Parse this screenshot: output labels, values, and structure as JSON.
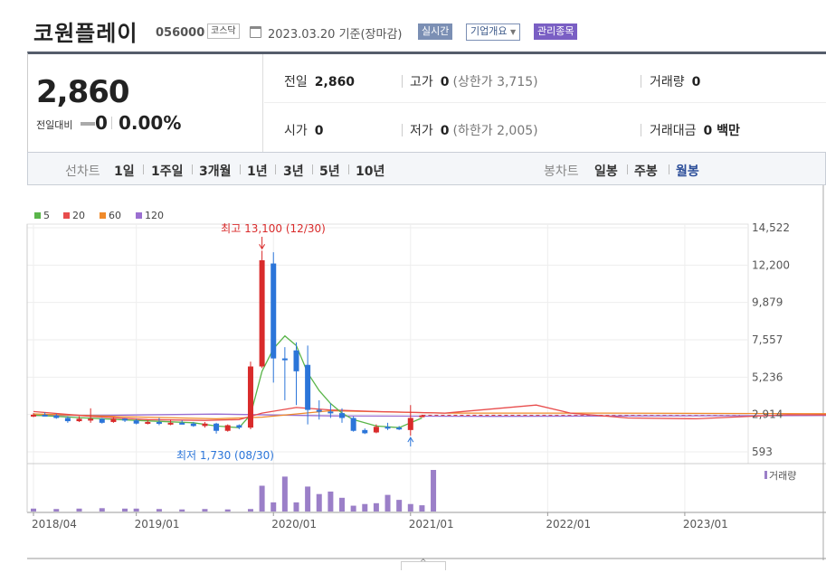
{
  "header": {
    "company_name": "코원플레이",
    "code": "056000",
    "market": "코스닥",
    "as_of": "2023.03.20 기준(장마감)",
    "realtime_label": "실시간",
    "company_overview_label": "기업개요",
    "admin_label": "관리종목"
  },
  "price": {
    "current": "2,860",
    "change_label": "전일대비",
    "change_value": "0",
    "change_pct": "0.00%",
    "prev_label": "전일",
    "prev_value": "2,860",
    "high_label": "고가",
    "high_value": "0",
    "upper_limit_text": "(상한가 3,715)",
    "volume_label": "거래량",
    "volume_value": "0",
    "open_label": "시가",
    "open_value": "0",
    "low_label": "저가",
    "low_value": "0",
    "lower_limit_text": "(하한가 2,005)",
    "amount_label": "거래대금",
    "amount_value": "0 백만"
  },
  "period_bar": {
    "line_label": "선차트",
    "line_periods": [
      "1일",
      "1주일",
      "3개월",
      "1년",
      "3년",
      "5년",
      "10년"
    ],
    "candle_label": "봉차트",
    "candle_periods": [
      "일봉",
      "주봉",
      "월봉"
    ],
    "active_candle": "월봉"
  },
  "colors": {
    "up": "#d92b2b",
    "down": "#2b75d9",
    "ma5": "#5ab54a",
    "ma20": "#e84c4c",
    "ma60": "#f08a2a",
    "ma120": "#9b6fd1",
    "volume": "#9b7fc8",
    "active": "#2d4f9a"
  },
  "chart_data": {
    "type": "candlestick",
    "legend": [
      {
        "name": "5",
        "color": "#5ab54a"
      },
      {
        "name": "20",
        "color": "#e84c4c"
      },
      {
        "name": "60",
        "color": "#f08a2a"
      },
      {
        "name": "120",
        "color": "#9b6fd1"
      }
    ],
    "y_ticks": [
      "14,522",
      "12,200",
      "9,879",
      "7,557",
      "5,236",
      "2,914",
      "593"
    ],
    "ylim": [
      593,
      14522
    ],
    "x_ticks": [
      "2018/04",
      "2019/01",
      "2020/01",
      "2021/01",
      "2022/01",
      "2023/01"
    ],
    "max_annotation": "최고 13,100 (12/30)",
    "min_annotation": "최저 1,730 (08/30)",
    "volume_label": "거래량",
    "candles": [
      {
        "m": "2018-04",
        "o": 2850,
        "c": 2900,
        "h": 3000,
        "l": 2750
      },
      {
        "m": "2018-05",
        "o": 2900,
        "c": 2850,
        "h": 3050,
        "l": 2800
      },
      {
        "m": "2018-06",
        "o": 2850,
        "c": 2700,
        "h": 2950,
        "l": 2650
      },
      {
        "m": "2018-07",
        "o": 2700,
        "c": 2500,
        "h": 2800,
        "l": 2400
      },
      {
        "m": "2018-08",
        "o": 2500,
        "c": 2650,
        "h": 2800,
        "l": 2450
      },
      {
        "m": "2018-09",
        "o": 2650,
        "c": 2650,
        "h": 3300,
        "l": 2400
      },
      {
        "m": "2018-10",
        "o": 2650,
        "c": 2400,
        "h": 2700,
        "l": 2350
      },
      {
        "m": "2018-11",
        "o": 2450,
        "c": 2650,
        "h": 2750,
        "l": 2400
      },
      {
        "m": "2018-12",
        "o": 2650,
        "c": 2550,
        "h": 2700,
        "l": 2450
      },
      {
        "m": "2019-01",
        "o": 2550,
        "c": 2350,
        "h": 2650,
        "l": 2300
      },
      {
        "m": "2019-02",
        "o": 2350,
        "c": 2450,
        "h": 2550,
        "l": 2300
      },
      {
        "m": "2019-03",
        "o": 2450,
        "c": 2350,
        "h": 2700,
        "l": 2250
      },
      {
        "m": "2019-04",
        "o": 2300,
        "c": 2400,
        "h": 2600,
        "l": 2250
      },
      {
        "m": "2019-05",
        "o": 2400,
        "c": 2350,
        "h": 2550,
        "l": 2300
      },
      {
        "m": "2019-06",
        "o": 2350,
        "c": 2200,
        "h": 2450,
        "l": 2150
      },
      {
        "m": "2019-07",
        "o": 2200,
        "c": 2350,
        "h": 2450,
        "l": 2100
      },
      {
        "m": "2019-08",
        "o": 2350,
        "c": 1900,
        "h": 2400,
        "l": 1730
      },
      {
        "m": "2019-09",
        "o": 1900,
        "c": 2250,
        "h": 2300,
        "l": 1850
      },
      {
        "m": "2019-10",
        "o": 2250,
        "c": 2100,
        "h": 2300,
        "l": 2000
      },
      {
        "m": "2019-11",
        "o": 2100,
        "c": 5900,
        "h": 6200,
        "l": 2000
      },
      {
        "m": "2019-12",
        "o": 5900,
        "c": 12500,
        "h": 13100,
        "l": 5800
      },
      {
        "m": "2020-01",
        "o": 12300,
        "c": 6400,
        "h": 13000,
        "l": 4900
      },
      {
        "m": "2020-02",
        "o": 6400,
        "c": 6300,
        "h": 7100,
        "l": 3800
      },
      {
        "m": "2020-03",
        "o": 6900,
        "c": 5600,
        "h": 7400,
        "l": 3500
      },
      {
        "m": "2020-04",
        "o": 6000,
        "c": 3200,
        "h": 7200,
        "l": 2300
      },
      {
        "m": "2020-05",
        "o": 3200,
        "c": 3100,
        "h": 3800,
        "l": 2600
      },
      {
        "m": "2020-06",
        "o": 3100,
        "c": 3000,
        "h": 3600,
        "l": 2700
      },
      {
        "m": "2020-07",
        "o": 3000,
        "c": 2700,
        "h": 3300,
        "l": 2400
      },
      {
        "m": "2020-08",
        "o": 2700,
        "c": 1900,
        "h": 2800,
        "l": 1850
      },
      {
        "m": "2020-09",
        "o": 1950,
        "c": 1750,
        "h": 2050,
        "l": 1700
      },
      {
        "m": "2020-10",
        "o": 1800,
        "c": 2150,
        "h": 2300,
        "l": 1750
      },
      {
        "m": "2020-11",
        "o": 2150,
        "c": 2100,
        "h": 2400,
        "l": 1950
      },
      {
        "m": "2020-12",
        "o": 2100,
        "c": 2050,
        "h": 2200,
        "l": 1950
      },
      {
        "m": "2021-01",
        "o": 1950,
        "c": 2700,
        "h": 3500,
        "l": 1600
      },
      {
        "m": "2021-02",
        "o": 2860,
        "c": 2860,
        "h": 2900,
        "l": 2860
      }
    ],
    "ma5": [
      [
        0,
        2880
      ],
      [
        4,
        2720
      ],
      [
        9,
        2550
      ],
      [
        14,
        2400
      ],
      [
        16,
        2200
      ],
      [
        18,
        2100
      ],
      [
        19,
        2900
      ],
      [
        20,
        5600
      ],
      [
        21,
        7000
      ],
      [
        22,
        7800
      ],
      [
        23,
        7200
      ],
      [
        24,
        5500
      ],
      [
        25,
        4400
      ],
      [
        26,
        3600
      ],
      [
        27,
        3000
      ],
      [
        28,
        2600
      ],
      [
        30,
        2200
      ],
      [
        32,
        2100
      ],
      [
        33,
        2400
      ],
      [
        34,
        2700
      ]
    ],
    "ma20": [
      [
        0,
        3100
      ],
      [
        5,
        2800
      ],
      [
        10,
        2600
      ],
      [
        15,
        2550
      ],
      [
        18,
        2600
      ],
      [
        20,
        3000
      ],
      [
        23,
        3350
      ],
      [
        26,
        3200
      ],
      [
        30,
        3100
      ],
      [
        36,
        3000
      ],
      [
        44,
        3500
      ],
      [
        47,
        3000
      ],
      [
        52,
        2700
      ],
      [
        58,
        2650
      ],
      [
        66,
        2900
      ],
      [
        74,
        2880
      ]
    ],
    "ma60": [
      [
        0,
        2950
      ],
      [
        8,
        2780
      ],
      [
        16,
        2650
      ],
      [
        20,
        2750
      ],
      [
        26,
        3150
      ],
      [
        36,
        3000
      ],
      [
        50,
        3000
      ],
      [
        74,
        2950
      ]
    ],
    "ma120": [
      [
        0,
        2850
      ],
      [
        8,
        2880
      ],
      [
        16,
        2940
      ],
      [
        26,
        2830
      ],
      [
        40,
        2800
      ],
      [
        74,
        2860
      ]
    ],
    "volumes": [
      [
        0,
        0.07
      ],
      [
        2,
        0.06
      ],
      [
        4,
        0.07
      ],
      [
        6,
        0.08
      ],
      [
        8,
        0.07
      ],
      [
        9,
        0.07
      ],
      [
        11,
        0.06
      ],
      [
        13,
        0.05
      ],
      [
        15,
        0.06
      ],
      [
        17,
        0.05
      ],
      [
        19,
        0.06
      ],
      [
        20,
        0.62
      ],
      [
        21,
        0.22
      ],
      [
        22,
        0.84
      ],
      [
        23,
        0.22
      ],
      [
        24,
        0.6
      ],
      [
        25,
        0.42
      ],
      [
        26,
        0.48
      ],
      [
        27,
        0.33
      ],
      [
        28,
        0.14
      ],
      [
        29,
        0.18
      ],
      [
        30,
        0.2
      ],
      [
        31,
        0.4
      ],
      [
        32,
        0.28
      ],
      [
        33,
        0.18
      ],
      [
        34,
        0.15
      ],
      [
        35,
        1.0
      ]
    ]
  }
}
